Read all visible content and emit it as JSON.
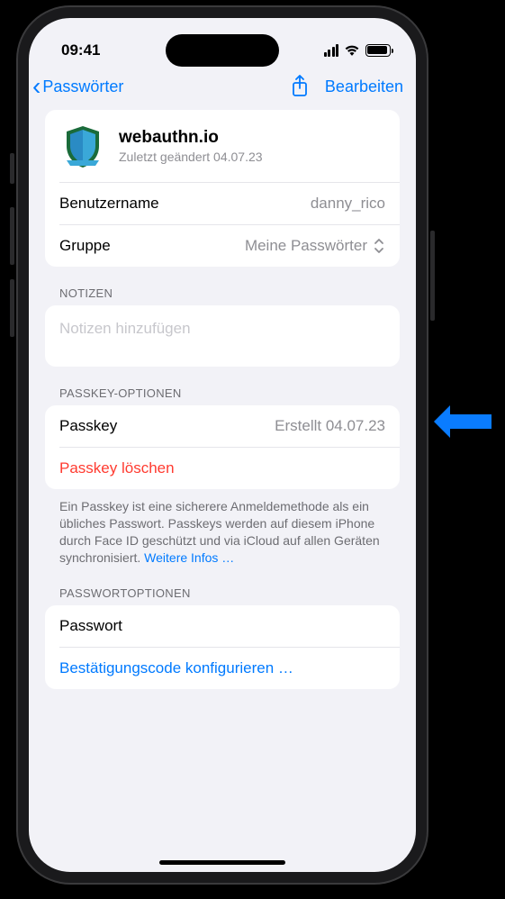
{
  "status": {
    "time": "09:41"
  },
  "nav": {
    "back": "Passwörter",
    "edit": "Bearbeiten"
  },
  "site": {
    "name": "webauthn.io",
    "subtitle": "Zuletzt geändert 04.07.23"
  },
  "rows": {
    "username_label": "Benutzername",
    "username_value": "danny_rico",
    "group_label": "Gruppe",
    "group_value": "Meine Passwörter"
  },
  "sections": {
    "notes": "NOTIZEN",
    "passkey_options": "PASSKEY-OPTIONEN",
    "password_options": "PASSWORTOPTIONEN"
  },
  "notes": {
    "placeholder": "Notizen hinzufügen"
  },
  "passkey": {
    "label": "Passkey",
    "value": "Erstellt 04.07.23",
    "delete": "Passkey löschen",
    "footer": "Ein Passkey ist eine sicherere Anmeldemethode als ein übliches Passwort. Passkeys werden auf diesem iPhone durch Face ID geschützt und via iCloud auf allen Geräten synchronisiert. ",
    "more": "Weitere Infos …"
  },
  "password": {
    "label": "Passwort",
    "setup_code": "Bestätigungscode konfigurieren …"
  }
}
